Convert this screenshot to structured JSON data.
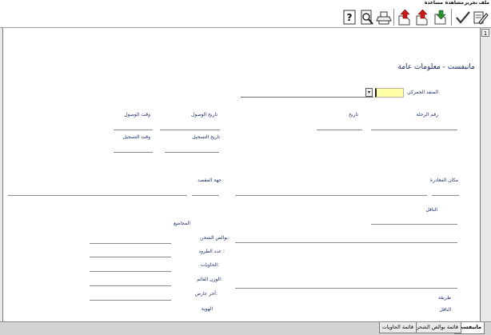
{
  "menu": {
    "items": [
      "ملف",
      "تحرير",
      "مشاهدة",
      "مساعدة"
    ]
  },
  "toolbar": {
    "buttons": [
      {
        "icon": "edit-form-icon"
      },
      {
        "icon": "checkmark-icon"
      },
      {
        "icon": "download-arrow-icon"
      },
      {
        "icon": "upload-arrow-icon"
      },
      {
        "icon": "upload-arrow-icon"
      },
      {
        "icon": "printer-icon"
      },
      {
        "icon": "print-preview-icon"
      },
      {
        "icon": "help-icon"
      }
    ],
    "help_glyph": "?"
  },
  "page": {
    "number": "1"
  },
  "form": {
    "title": "مانيفست - معلومات عامة",
    "labels": {
      "customs_point": "المنفذ الجمركي",
      "voyage_number": "رقم الرحلة",
      "date": "تاريخ",
      "arrival_date": "تاريخ الوصول",
      "arrival_time": "وقت الوصول",
      "registration_date": "تاريخ التسجيل",
      "registration_time": "وقت التسجيل",
      "departure_place": "مكان المغادرة",
      "destination": "جهة المقصد",
      "carrier": "الناقل",
      "totals": "المجاميع",
      "bills_of_lading": "بوالص الشحن:",
      "packages_count": "عدد الطرود :",
      "containers": "الحاويات:",
      "gross_weight": "الوزن القائم:",
      "last_seal": "آخر عارض:",
      "method": "طريقة",
      "carrier2": "الناقل",
      "identity": "الهوية"
    },
    "values": {
      "customs_point": ""
    }
  },
  "tabs": [
    {
      "label": "مانيفست",
      "active": true
    },
    {
      "label": "قائمة بوالص الشحن",
      "active": false
    },
    {
      "label": "قائمة الحاويات",
      "active": false
    }
  ],
  "colors": {
    "label": "#1a2a6c",
    "input_highlight": "#ffffa8",
    "arrow_green": "#2e8b2e",
    "arrow_red": "#c81818"
  }
}
